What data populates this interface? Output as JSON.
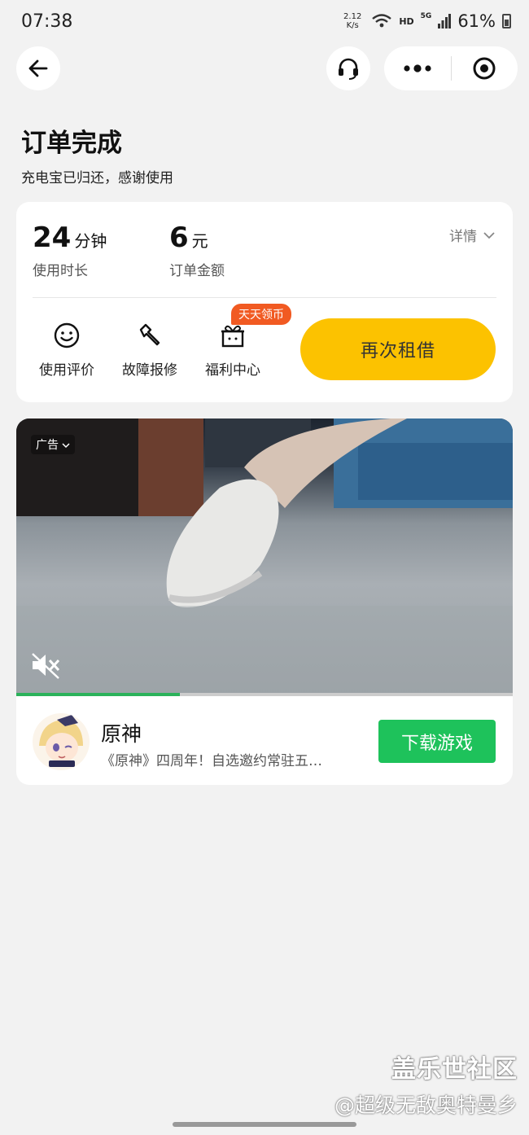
{
  "status_bar": {
    "time": "07:38",
    "net_speed_value": "2.12",
    "net_speed_unit": "K/s",
    "hd": "HD",
    "signal_type": "5G",
    "battery": "61%"
  },
  "header": {
    "title": "订单完成",
    "subtitle": "充电宝已归还，感谢使用"
  },
  "order": {
    "duration_value": "24",
    "duration_unit": "分钟",
    "duration_label": "使用时长",
    "amount_value": "6",
    "amount_unit": "元",
    "amount_label": "订单金额",
    "detail_label": "详情",
    "actions": [
      {
        "label": "使用评价",
        "icon": "smiley-icon"
      },
      {
        "label": "故障报修",
        "icon": "wrench-icon"
      },
      {
        "label": "福利中心",
        "icon": "gift-icon"
      }
    ],
    "promo_badge": "天天领币",
    "rent_again_label": "再次租借"
  },
  "ad": {
    "ad_label": "广告",
    "video_progress": 0.33,
    "app_name": "原神",
    "app_desc": "《原神》四周年！自选邀约常驻五…",
    "download_label": "下载游戏"
  },
  "watermark": {
    "line1": "盖乐世社区",
    "line2": "@超级无敌奥特曼乡"
  },
  "colors": {
    "accent_yellow": "#fcc200",
    "download_green": "#1ec25b",
    "promo_orange": "#f15a22",
    "background": "#f2f2f2"
  }
}
